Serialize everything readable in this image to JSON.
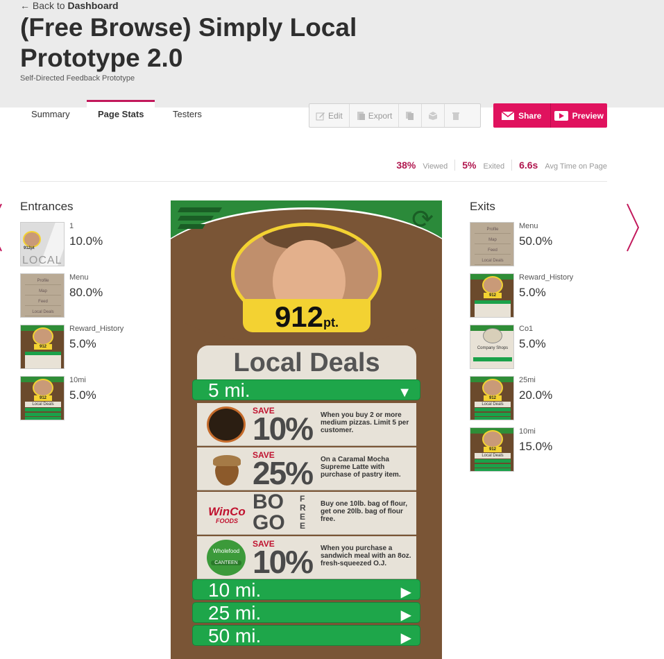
{
  "header": {
    "back_arrow": "←",
    "back_prefix": "Back to",
    "back_target": "Dashboard",
    "title": "(Free Browse) Simply Local Prototype 2.0",
    "subtitle": "Self-Directed Feedback Prototype"
  },
  "tabs": [
    {
      "label": "Summary"
    },
    {
      "label": "Page Stats",
      "active": true
    },
    {
      "label": "Testers"
    }
  ],
  "toolbar": {
    "edit": "Edit",
    "export": "Export",
    "share": "Share",
    "preview": "Preview",
    "accent": "#e0125e"
  },
  "stats": [
    {
      "value": "38%",
      "label": "Viewed"
    },
    {
      "value": "5%",
      "label": "Exited"
    },
    {
      "value": "6.6s",
      "label": "Avg Time on Page"
    }
  ],
  "entrances": {
    "title": "Entrances",
    "items": [
      {
        "name": "1",
        "pct": "10.0%",
        "thumb": "local",
        "thumb_text": "LOCAL",
        "thumb_points": "912pt"
      },
      {
        "name": "Menu",
        "pct": "80.0%",
        "thumb": "menu",
        "thumb_items": [
          "Profile",
          "Map",
          "Feed",
          "Local Deals"
        ]
      },
      {
        "name": "Reward_History",
        "pct": "5.0%",
        "thumb": "wood",
        "thumb_points": "912"
      },
      {
        "name": "10mi",
        "pct": "5.0%",
        "thumb": "wood-deals",
        "thumb_points": "912",
        "thumb_text": "Local Deals"
      }
    ]
  },
  "exits": {
    "title": "Exits",
    "items": [
      {
        "name": "Menu",
        "pct": "50.0%",
        "thumb": "menu",
        "thumb_items": [
          "Profile",
          "Map",
          "Feed",
          "Local Deals"
        ]
      },
      {
        "name": "Reward_History",
        "pct": "5.0%",
        "thumb": "wood",
        "thumb_points": "912"
      },
      {
        "name": "Co1",
        "pct": "5.0%",
        "thumb": "co",
        "thumb_text": "Company Shops"
      },
      {
        "name": "25mi",
        "pct": "20.0%",
        "thumb": "wood-deals",
        "thumb_points": "912",
        "thumb_text": "Local Deals"
      },
      {
        "name": "10mi",
        "pct": "15.0%",
        "thumb": "wood-deals",
        "thumb_points": "912",
        "thumb_text": "Local Deals"
      }
    ]
  },
  "phone": {
    "points": "912",
    "points_unit": "pt.",
    "section_title": "Local Deals",
    "distance_selected": "5 mi.",
    "deals": [
      {
        "save": "SAVE",
        "value": "10%",
        "text": "When you buy 2 or more medium pizzas. Limit 5 per customer.",
        "logo": "pizza",
        "color": "#2b1e12"
      },
      {
        "save": "SAVE",
        "value": "25%",
        "text": "On a Caramal Mocha Supreme Latte with purchase of pastry item.",
        "logo": "acorn",
        "color": "#8c5a2b"
      },
      {
        "bogo_top": "BO",
        "bogo_bottom": "GO",
        "free": "FREE",
        "text": "Buy one 10lb. bag of flour, get one 20lb. bag of flour free.",
        "logo": "winco",
        "logo_text": "WinCo",
        "logo_sub": "FOODS",
        "color": "#c0122f"
      },
      {
        "save": "SAVE",
        "value": "10%",
        "text": "When you purchase a sandwich meal with an 8oz. fresh-squeezed O.J.",
        "logo": "wholefood",
        "logo_text": "Wholefood",
        "logo_sub": "CANTEEN",
        "color": "#3c9a3a"
      }
    ],
    "other_distances": [
      "10 mi.",
      "25 mi.",
      "50 mi."
    ]
  }
}
